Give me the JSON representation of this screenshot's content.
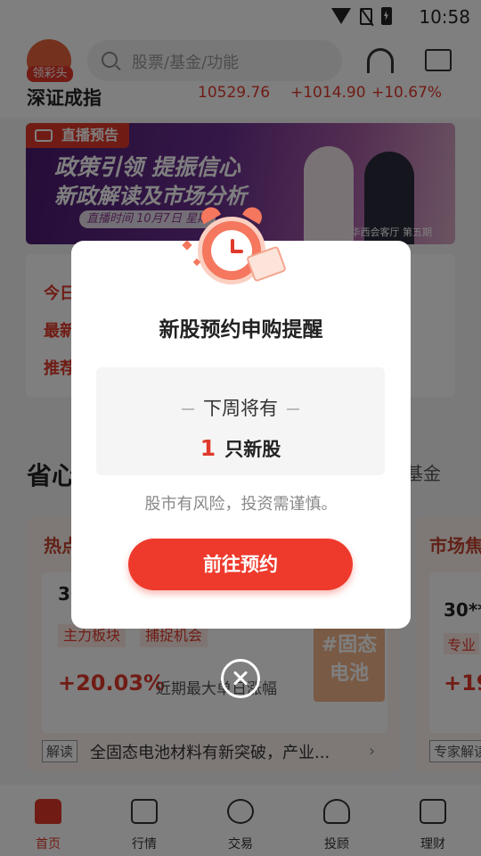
{
  "status_bar": {
    "time": "10:58"
  },
  "header": {
    "lottery_label": "领彩头",
    "search_placeholder": "股票/基金/功能"
  },
  "index_row": {
    "name": "深证成指",
    "value": "10529.76",
    "change": "+1014.90",
    "change_pct": "+10.67%"
  },
  "banner": {
    "tag": "直播预告",
    "title_line1": "政策引领 提振信心",
    "title_line2": "新政解读及市场分析",
    "time": "直播时间 10月7日 星期",
    "caption": "华西会客厅 第五期"
  },
  "info_card": {
    "lines": [
      "今日",
      "最新",
      "推荐"
    ]
  },
  "section": {
    "title": "省心",
    "fund_chip": "基金"
  },
  "hot_card": {
    "title": "热点",
    "code": "30",
    "tags": [
      "主力板块",
      "捕捉机会"
    ],
    "pct": "+20.03%",
    "note": "近期最大单日涨幅",
    "theme": [
      "#固态",
      "电池"
    ],
    "interp_tag": "解读",
    "interp_text": "全固态电池材料有新突破，产业...",
    "arrow": "›"
  },
  "market_card": {
    "title": "市场焦",
    "code": "30**",
    "tag": "专业",
    "pct": "+19",
    "expert_tag": "专家解读"
  },
  "bottom_nav": [
    {
      "label": "首页",
      "icon": "home-icon",
      "active": true
    },
    {
      "label": "行情",
      "icon": "market-icon",
      "active": false
    },
    {
      "label": "交易",
      "icon": "trade-icon",
      "active": false
    },
    {
      "label": "投顾",
      "icon": "advisor-icon",
      "active": false
    },
    {
      "label": "理财",
      "icon": "wealth-icon",
      "active": false
    }
  ],
  "modal": {
    "title": "新股预约申购提醒",
    "subtitle": "下周将有",
    "count": "1",
    "count_unit": "只新股",
    "risk_note": "股市有风险，投资需谨慎。",
    "button_label": "前往预约",
    "illustration": "alarm-clock-icon"
  },
  "colors": {
    "accent": "#ee3a2c",
    "overlay": "rgba(0,0,0,0.5)"
  }
}
